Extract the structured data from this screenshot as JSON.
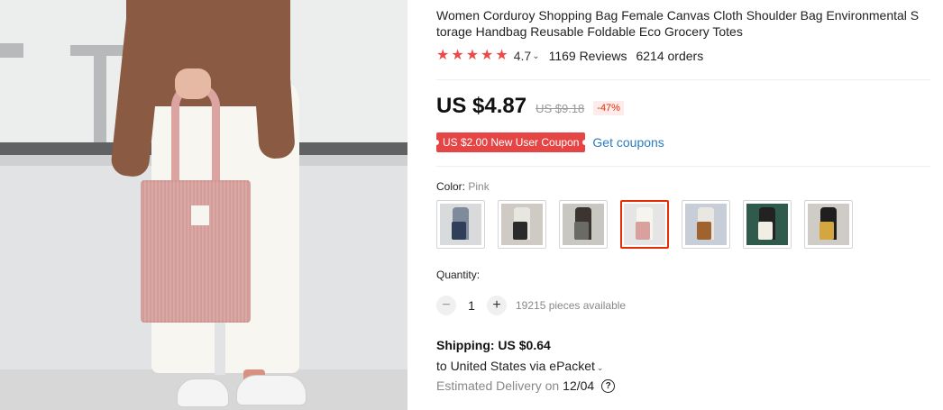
{
  "product": {
    "title": "Women Corduroy Shopping Bag Female Canvas Cloth Shoulder Bag Environmental Storage Handbag Reusable Foldable Eco Grocery Totes",
    "title_line1": "Women Corduroy Shopping Bag Female Canvas Cloth Shoulder Bag Environmental S",
    "title_line2": "torage Handbag Reusable Foldable Eco Grocery Totes"
  },
  "rating": {
    "stars": 5,
    "value": "4.7",
    "reviews": "1169 Reviews",
    "orders": "6214 orders",
    "star_color": "#ec4a4a"
  },
  "price": {
    "current": "US $4.87",
    "original": "US $9.18",
    "discount": "-47%"
  },
  "coupon": {
    "badge": "US $2.00 New User Coupon",
    "link": "Get coupons",
    "badge_color": "#e64545",
    "link_color": "#2a7bc0"
  },
  "color": {
    "label": "Color:",
    "selected": "Pink",
    "options": [
      {
        "name": "Blue",
        "bag": "#2f3f5a",
        "bg": "#d9dadc",
        "fig": "#7f8a9a"
      },
      {
        "name": "Black",
        "bag": "#2b2b2b",
        "bg": "#cfcac4",
        "fig": "#e8e6e1"
      },
      {
        "name": "Grey",
        "bag": "#6b6b66",
        "bg": "#c9c7c2",
        "fig": "#3b3430"
      },
      {
        "name": "Pink",
        "bag": "#d9a19d",
        "bg": "#e5e5e6",
        "fig": "#f5f4ef"
      },
      {
        "name": "Brown",
        "bag": "#a0622e",
        "bg": "#c7ced8",
        "fig": "#e9e7e2"
      },
      {
        "name": "White",
        "bag": "#f1eee6",
        "bg": "#2f5a4c",
        "fig": "#222"
      },
      {
        "name": "Yellow",
        "bag": "#d4a640",
        "bg": "#cfcbc6",
        "fig": "#1f1f1f"
      }
    ]
  },
  "quantity": {
    "label": "Quantity:",
    "value": "1",
    "minus": "−",
    "plus": "+",
    "available": "19215 pieces available"
  },
  "shipping": {
    "cost": "Shipping: US $0.64",
    "destination": "to United States via ePacket",
    "delivery_label": "Estimated Delivery on",
    "delivery_date": "12/04",
    "help": "?"
  }
}
